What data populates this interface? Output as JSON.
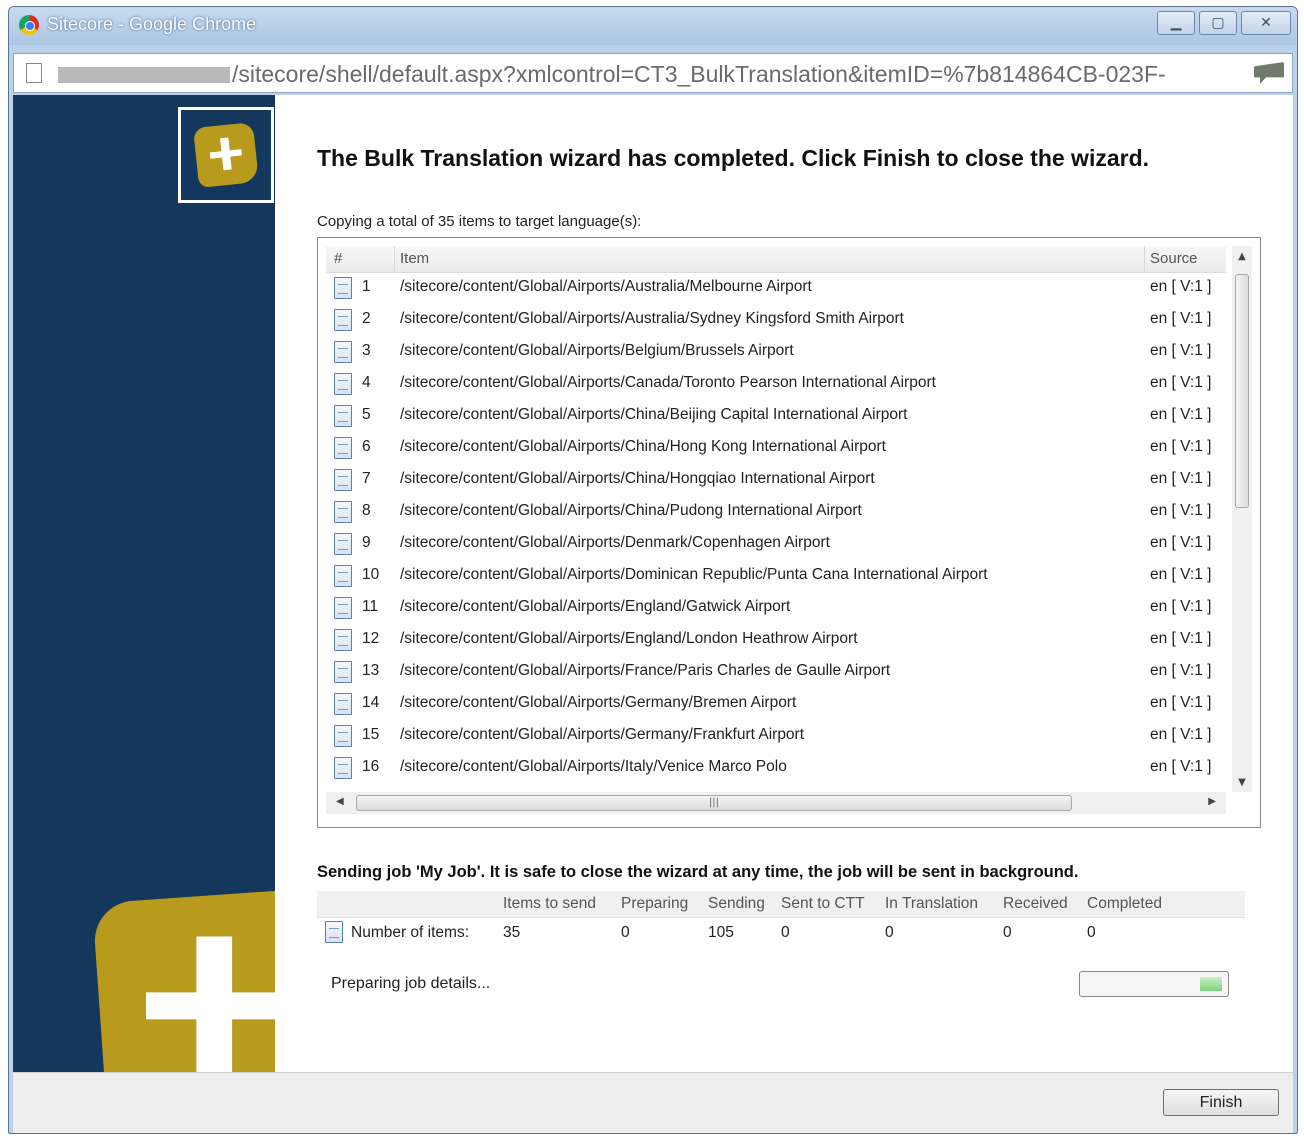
{
  "window": {
    "title": "Sitecore - Google Chrome",
    "url": "/sitecore/shell/default.aspx?xmlcontrol=CT3_BulkTranslation&itemID=%7b814864CB-023F-"
  },
  "wizard": {
    "heading": "The Bulk Translation wizard has completed. Click Finish to close the wizard.",
    "copy_text": "Copying a total of 35 items to target language(s):",
    "columns": {
      "num": "#",
      "item": "Item",
      "source": "Source"
    },
    "items": [
      {
        "num": "1",
        "path": "/sitecore/content/Global/Airports/Australia/Melbourne Airport",
        "source": "en [ V:1 ]"
      },
      {
        "num": "2",
        "path": "/sitecore/content/Global/Airports/Australia/Sydney Kingsford Smith Airport",
        "source": "en [ V:1 ]"
      },
      {
        "num": "3",
        "path": "/sitecore/content/Global/Airports/Belgium/Brussels Airport",
        "source": "en [ V:1 ]"
      },
      {
        "num": "4",
        "path": "/sitecore/content/Global/Airports/Canada/Toronto Pearson International Airport",
        "source": "en [ V:1 ]"
      },
      {
        "num": "5",
        "path": "/sitecore/content/Global/Airports/China/Beijing Capital International Airport",
        "source": "en [ V:1 ]"
      },
      {
        "num": "6",
        "path": "/sitecore/content/Global/Airports/China/Hong Kong International Airport",
        "source": "en [ V:1 ]"
      },
      {
        "num": "7",
        "path": "/sitecore/content/Global/Airports/China/Hongqiao International Airport",
        "source": "en [ V:1 ]"
      },
      {
        "num": "8",
        "path": "/sitecore/content/Global/Airports/China/Pudong International Airport",
        "source": "en [ V:1 ]"
      },
      {
        "num": "9",
        "path": "/sitecore/content/Global/Airports/Denmark/Copenhagen Airport",
        "source": "en [ V:1 ]"
      },
      {
        "num": "10",
        "path": "/sitecore/content/Global/Airports/Dominican Republic/Punta Cana International Airport",
        "source": "en [ V:1 ]"
      },
      {
        "num": "11",
        "path": "/sitecore/content/Global/Airports/England/Gatwick Airport",
        "source": "en [ V:1 ]"
      },
      {
        "num": "12",
        "path": "/sitecore/content/Global/Airports/England/London Heathrow Airport",
        "source": "en [ V:1 ]"
      },
      {
        "num": "13",
        "path": "/sitecore/content/Global/Airports/France/Paris Charles de Gaulle Airport",
        "source": "en [ V:1 ]"
      },
      {
        "num": "14",
        "path": "/sitecore/content/Global/Airports/Germany/Bremen Airport",
        "source": "en [ V:1 ]"
      },
      {
        "num": "15",
        "path": "/sitecore/content/Global/Airports/Germany/Frankfurt Airport",
        "source": "en [ V:1 ]"
      },
      {
        "num": "16",
        "path": "/sitecore/content/Global/Airports/Italy/Venice Marco Polo",
        "source": "en [ V:1 ]"
      }
    ]
  },
  "job": {
    "sending_text": "Sending job 'My Job'. It is safe to close the wizard at any time, the job will be sent in background.",
    "columns": [
      "Items to send",
      "Preparing",
      "Sending",
      "Sent to CTT",
      "In Translation",
      "Received",
      "Completed"
    ],
    "row_label": "Number of items:",
    "values": [
      "35",
      "0",
      "105",
      "0",
      "0",
      "0",
      "0"
    ],
    "status": "Preparing job details...",
    "progress_fraction": 0.15
  },
  "footer": {
    "finish_label": "Finish"
  },
  "colors": {
    "sidebar": "#14375e",
    "logo": "#b89a1c"
  },
  "icons": [
    "chrome-icon",
    "minimize-icon",
    "maximize-icon",
    "close-icon",
    "page-icon",
    "document-icon",
    "sitecore-logo-icon"
  ]
}
